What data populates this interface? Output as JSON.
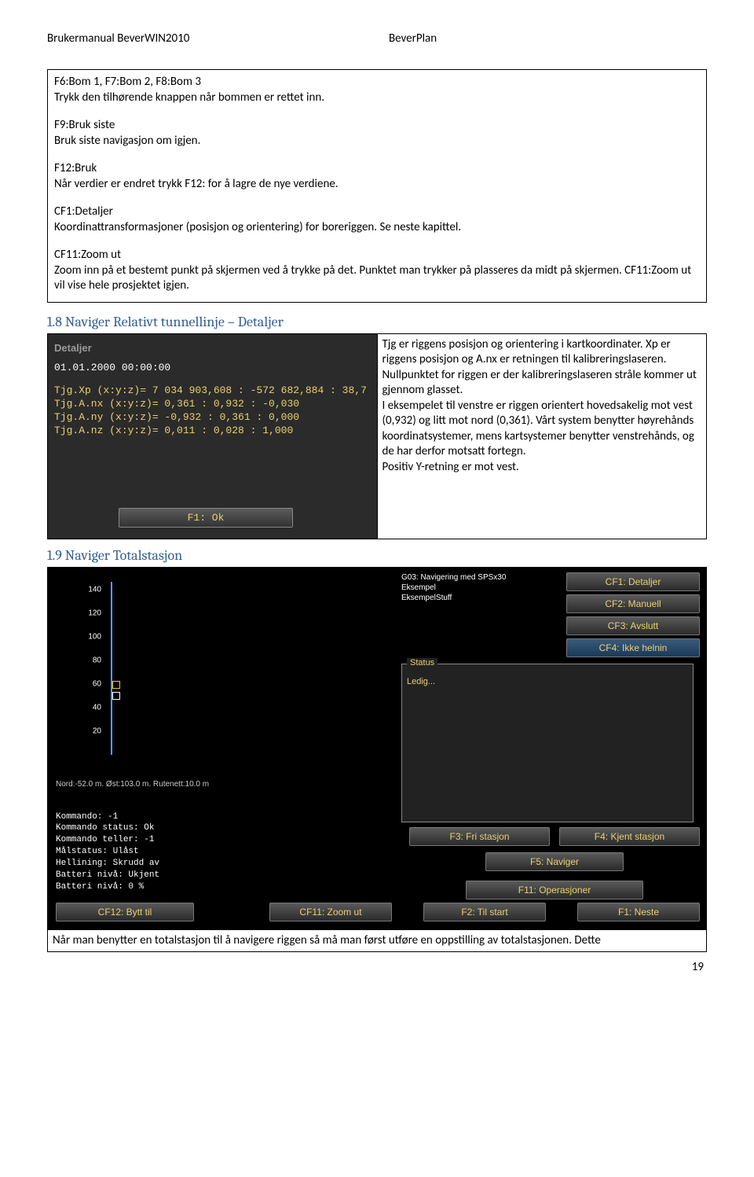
{
  "header": {
    "left": "Brukermanual BeverWIN2010",
    "center": "BeverPlan"
  },
  "box1": {
    "l1": "F6:Bom 1, F7:Bom 2, F8:Bom 3",
    "l2": "Trykk den tilhørende knappen når bommen er rettet inn.",
    "l3": "F9:Bruk siste",
    "l4": "Bruk siste navigasjon om igjen.",
    "l5": "F12:Bruk",
    "l6": "Når verdier er endret trykk F12: for å lagre de nye verdiene.",
    "l7": "CF1:Detaljer",
    "l8": "Koordinattransformasjoner (posisjon og orientering) for boreriggen. Se neste kapittel.",
    "l9": "CF11:Zoom ut",
    "l10": "Zoom inn på et bestemt punkt på skjermen ved å trykke på det. Punktet man trykker på plasseres da midt på skjermen. CF11:Zoom ut vil vise hele prosjektet igjen."
  },
  "sec18": {
    "title": "1.8   Naviger Relativt tunnellinje – Detaljer",
    "panel": {
      "title": "Detaljer",
      "time": "01.01.2000 00:00:00",
      "l1": "Tjg.Xp (x:y:z)= 7 034 903,608 : -572 682,884 : 38,7",
      "l2": "Tjg.A.nx (x:y:z)= 0,361 : 0,932 : -0,030",
      "l3": "Tjg.A.ny (x:y:z)= -0,932 : 0,361 : 0,000",
      "l4": "Tjg.A.nz (x:y:z)= 0,011 : 0,028 : 1,000",
      "ok": "F1: Ok"
    },
    "right": "Tjg er riggens posisjon og orientering i kartkoordinater. Xp er riggens posisjon og A.nx er retningen til kalibreringslaseren. Nullpunktet for riggen er der kalibreringslaseren stråle kommer ut gjennom glasset.\nI eksempelet til venstre er riggen orientert hovedsakelig mot vest (0,932) og litt mot nord (0,361). Vårt system benytter høyrehånds koordinatsystemer, mens kartsystemer benytter venstrehånds, og de har derfor motsatt fortegn.\nPositiv Y-retning er mot vest."
  },
  "sec19": {
    "title": "1.9   Naviger Totalstasjon",
    "topinfo": {
      "l1": "G03: Navigering med SPSx30",
      "l2": "Eksempel",
      "l3": "EksempelStuff"
    },
    "chart": {
      "ticks": [
        "140",
        "120",
        "100",
        "80",
        "60",
        "40",
        "20"
      ]
    },
    "buttons": {
      "cf1": "CF1: Detaljer",
      "cf2": "CF2: Manuell",
      "cf3": "CF3: Avslutt",
      "cf4": "CF4: Ikke helnin",
      "status_title": "Status",
      "status_text": "Ledig...",
      "f3": "F3: Fri stasjon",
      "f4": "F4: Kjent stasjon",
      "f5": "F5: Naviger",
      "f11": "F11: Operasjoner",
      "cf12": "CF12: Bytt til",
      "cf11": "CF11: Zoom ut",
      "f2": "F2: Til start",
      "f1": "F1: Neste"
    },
    "coordline": "Nord:-52.0 m. Øst:103.0 m. Rutenett:10.0 m",
    "leftinfo": {
      "l1": "Kommando: -1",
      "l2": "Kommando status: Ok",
      "l3": "Kommando teller: -1",
      "l4": "Målstatus: Ulåst",
      "l5": "Hellining: Skrudd av",
      "l6": "Batteri nivå: Ukjent",
      "l7": "Batteri nivå: 0 %"
    },
    "footer": "Når man benytter en totalstasjon til å navigere riggen så må man først utføre en oppstilling av totalstasjonen. Dette"
  },
  "pagenum": "19"
}
